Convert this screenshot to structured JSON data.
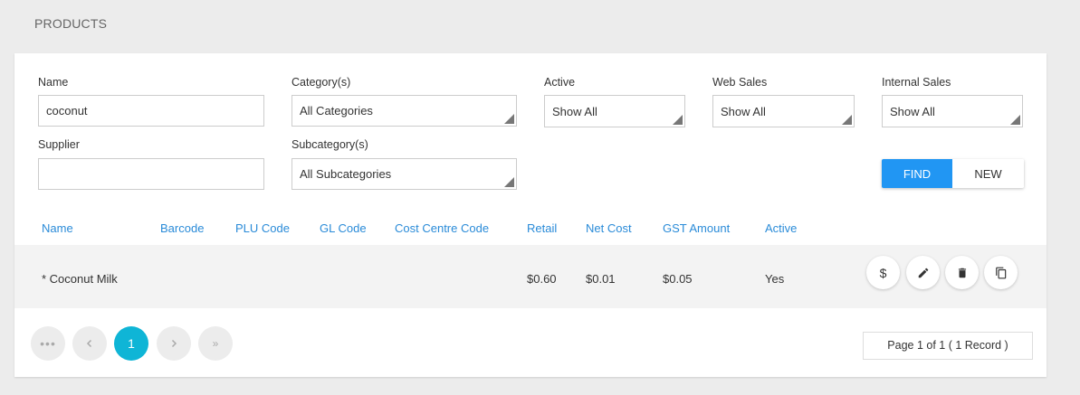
{
  "page": {
    "title": "PRODUCTS"
  },
  "filters": {
    "name": {
      "label": "Name",
      "value": "coconut"
    },
    "category": {
      "label": "Category(s)",
      "value": "All Categories"
    },
    "active": {
      "label": "Active",
      "value": "Show All"
    },
    "web_sales": {
      "label": "Web Sales",
      "value": "Show All"
    },
    "internal_sales": {
      "label": "Internal Sales",
      "value": "Show All"
    },
    "supplier": {
      "label": "Supplier",
      "value": ""
    },
    "subcategory": {
      "label": "Subcategory(s)",
      "value": "All Subcategories"
    }
  },
  "buttons": {
    "find": "FIND",
    "new": "NEW"
  },
  "table": {
    "columns": [
      "Name",
      "Barcode",
      "PLU Code",
      "GL Code",
      "Cost Centre Code",
      "Retail",
      "Net Cost",
      "GST Amount",
      "Active"
    ],
    "rows": [
      {
        "name": "* Coconut Milk",
        "barcode": "",
        "plu": "",
        "gl": "",
        "cost_centre": "",
        "retail": "$0.60",
        "net_cost": "$0.01",
        "gst": "$0.05",
        "active": "Yes"
      }
    ]
  },
  "row_actions": {
    "price": "$"
  },
  "pagination": {
    "current": "1",
    "info": "Page 1 of 1 ( 1 Record )"
  }
}
